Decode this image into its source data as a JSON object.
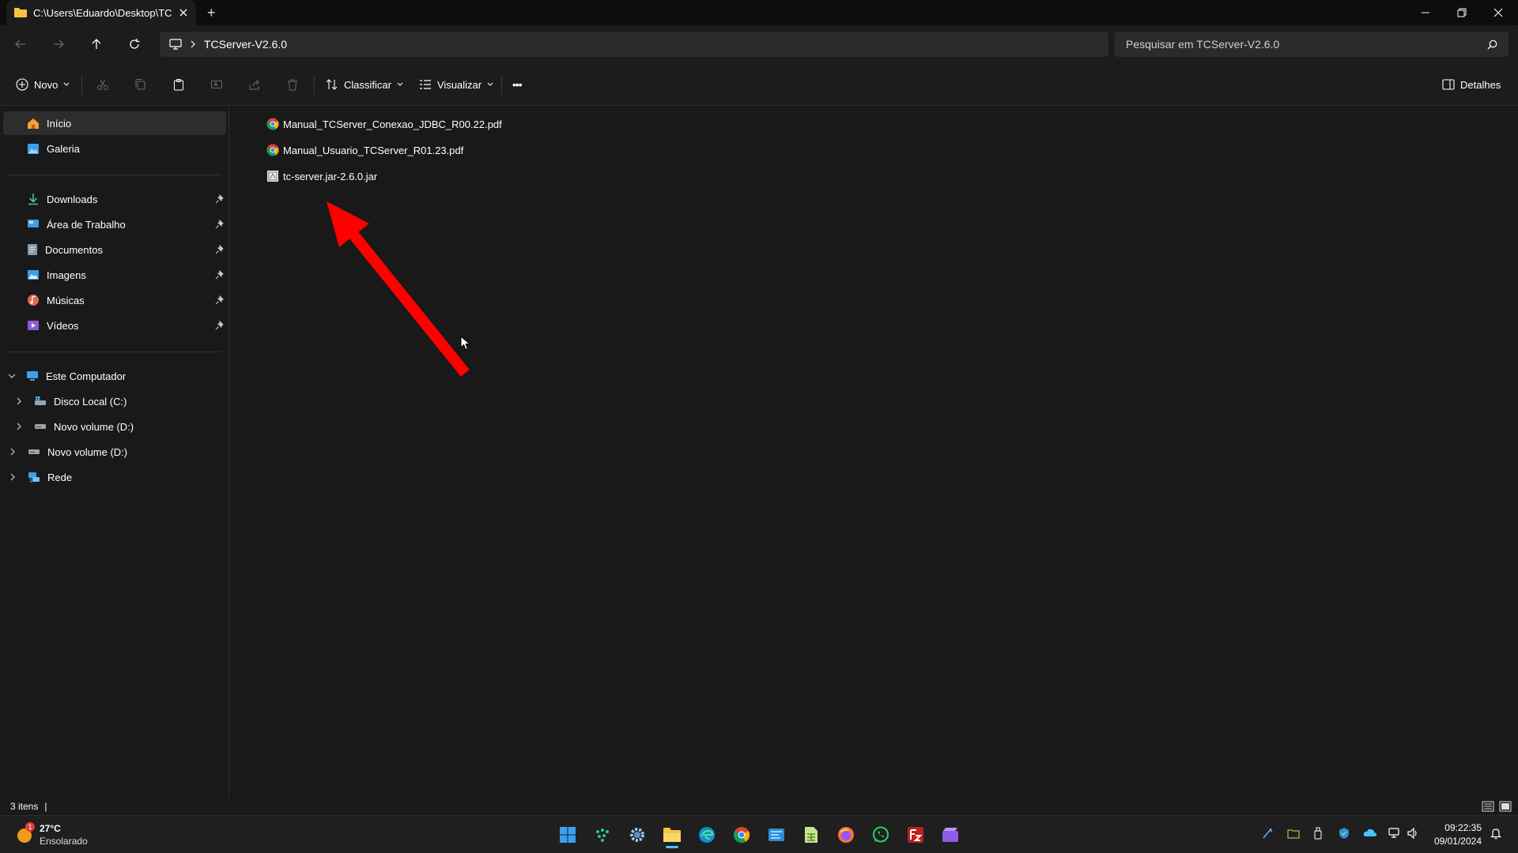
{
  "window": {
    "tab_title": "C:\\Users\\Eduardo\\Desktop\\TC",
    "new_tab_symbol": "+"
  },
  "nav": {
    "address_path": "TCServer-V2.6.0",
    "search_placeholder": "Pesquisar em TCServer-V2.6.0"
  },
  "toolbar": {
    "new_label": "Novo",
    "sort_label": "Classificar",
    "view_label": "Visualizar",
    "more_label": "•••",
    "details_label": "Detalhes"
  },
  "sidebar": {
    "home": "Início",
    "gallery": "Galeria",
    "quick_access": [
      {
        "label": "Downloads",
        "icon": "download-icon"
      },
      {
        "label": "Área de Trabalho",
        "icon": "desktop-icon"
      },
      {
        "label": "Documentos",
        "icon": "document-icon"
      },
      {
        "label": "Imagens",
        "icon": "image-icon"
      },
      {
        "label": "Músicas",
        "icon": "music-icon"
      },
      {
        "label": "Vídeos",
        "icon": "video-icon"
      }
    ],
    "this_pc": "Este Computador",
    "drives": [
      {
        "label": "Disco Local (C:)"
      },
      {
        "label": "Novo volume (D:)"
      }
    ],
    "extra_drive": "Novo volume (D:)",
    "network": "Rede"
  },
  "files": [
    {
      "name": "Manual_TCServer_Conexao_JDBC_R00.22.pdf",
      "icon": "chrome-pdf-icon"
    },
    {
      "name": "Manual_Usuario_TCServer_R01.23.pdf",
      "icon": "chrome-pdf-icon"
    },
    {
      "name": "tc-server.jar-2.6.0.jar",
      "icon": "jar-file-icon"
    }
  ],
  "status": {
    "item_count": "3 itens"
  },
  "taskbar": {
    "weather_temp": "27°C",
    "weather_desc": "Ensolarado",
    "weather_badge": "1",
    "time": "09:22:35",
    "date": "09/01/2024"
  },
  "colors": {
    "accent": "#4cc2ff",
    "folder": "#f4c542",
    "arrow": "#ff0000"
  }
}
